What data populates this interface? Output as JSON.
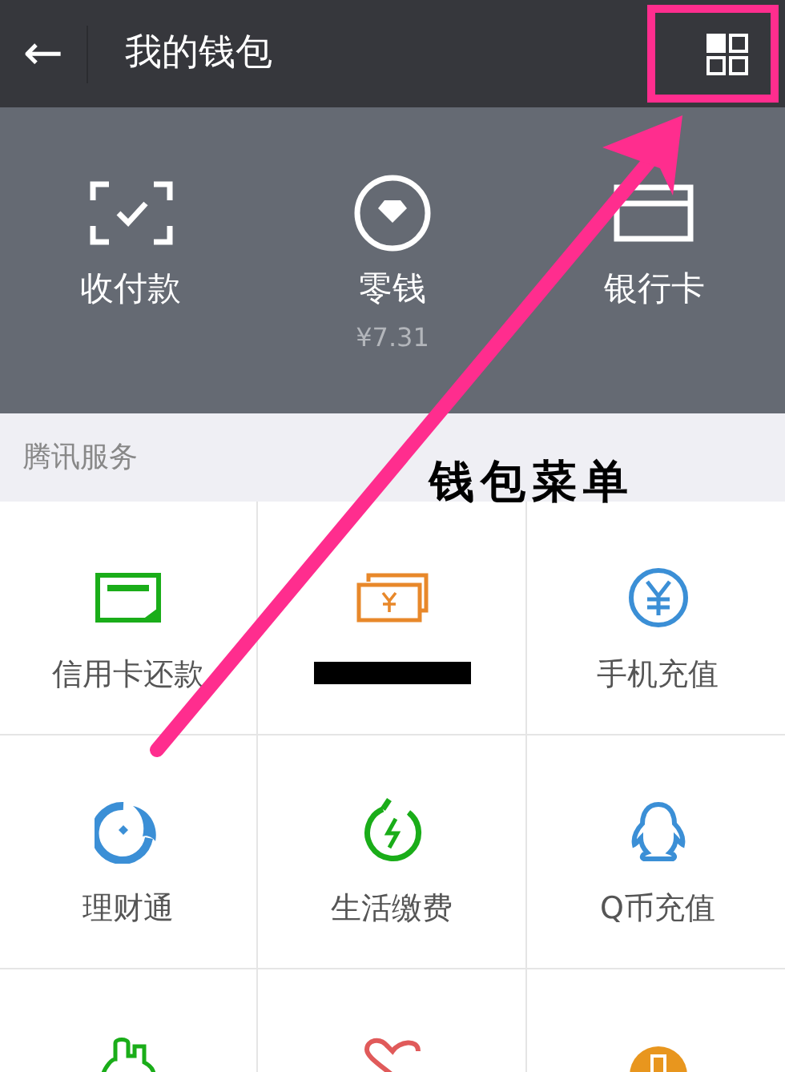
{
  "header": {
    "back_icon": "←",
    "title": "我的钱包"
  },
  "top_actions": [
    {
      "kind": "scan",
      "label": "收付款"
    },
    {
      "kind": "change",
      "label": "零钱",
      "sub": "¥7.31"
    },
    {
      "kind": "card",
      "label": "银行卡"
    }
  ],
  "section": {
    "title": "腾讯服务"
  },
  "services": [
    {
      "kind": "credit",
      "label": "信用卡还款"
    },
    {
      "kind": "loan",
      "redacted": true
    },
    {
      "kind": "phone",
      "label": "手机充值"
    },
    {
      "kind": "licaitong",
      "label": "理财通"
    },
    {
      "kind": "bills",
      "label": "生活缴费"
    },
    {
      "kind": "qq",
      "label": "Q币充值"
    },
    {
      "kind": "city"
    },
    {
      "kind": "charity"
    },
    {
      "kind": "orange"
    }
  ],
  "annotation": {
    "text": "钱包菜单"
  }
}
